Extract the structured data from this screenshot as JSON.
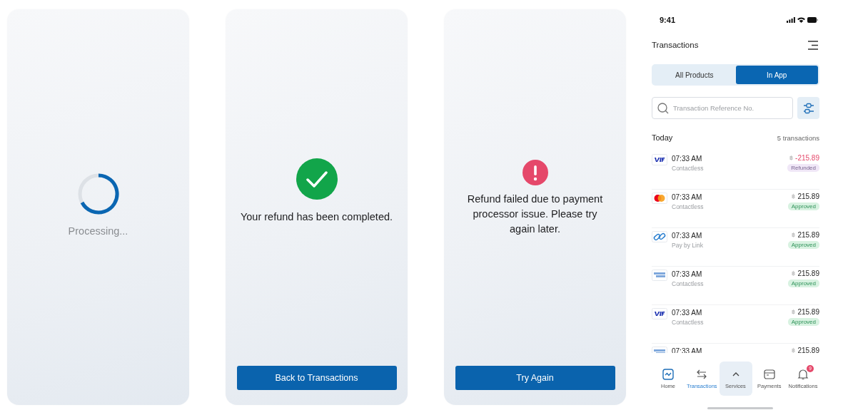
{
  "screens": [
    {
      "kind": "processing",
      "message": "Processing..."
    },
    {
      "kind": "success",
      "message": "Your refund has been completed.",
      "button": "Back to Transactions"
    },
    {
      "kind": "error",
      "message": "Refund failed due to payment processor issue. Please try again later.",
      "button": "Try Again"
    }
  ],
  "phone": {
    "status_bar": {
      "time": "9:41"
    },
    "title": "Transactions",
    "tabs": [
      {
        "label": "All Products",
        "selected": false
      },
      {
        "label": "In App",
        "selected": true
      }
    ],
    "search": {
      "placeholder": "Transaction Reference No."
    },
    "section": {
      "title": "Today",
      "count": "5 transactions"
    },
    "transactions": [
      {
        "kind": "visa",
        "time": "07:33 AM",
        "channel": "Contactless",
        "currency": "฿",
        "amount": "-215.89",
        "status": {
          "label": "Refunded",
          "kind": "refunded"
        }
      },
      {
        "kind": "mastercard",
        "time": "07:33 AM",
        "channel": "Contactless",
        "currency": "฿",
        "amount": "215.89",
        "status": {
          "label": "Approved",
          "kind": "approved"
        }
      },
      {
        "kind": "link",
        "time": "07:33 AM",
        "channel": "Pay by Link",
        "currency": "฿",
        "amount": "215.89",
        "status": {
          "label": "Approved",
          "kind": "approved"
        }
      },
      {
        "kind": "amex",
        "time": "07:33 AM",
        "channel": "Contactless",
        "currency": "฿",
        "amount": "215.89",
        "status": {
          "label": "Approved",
          "kind": "approved"
        }
      },
      {
        "kind": "visa",
        "time": "07:33 AM",
        "channel": "Contactless",
        "currency": "฿",
        "amount": "215.89",
        "status": {
          "label": "Approved",
          "kind": "approved"
        }
      },
      {
        "kind": "amex",
        "time": "07:33 AM",
        "currency": "฿",
        "amount": "215.89"
      }
    ],
    "nav": [
      {
        "kind": "home",
        "label": "Home",
        "selected": false
      },
      {
        "kind": "transfer",
        "label": "Transactions",
        "selected": true
      },
      {
        "kind": "caret",
        "label": "Services",
        "selected": false,
        "highlighted": true
      },
      {
        "kind": "card",
        "label": "Payments",
        "selected": false
      },
      {
        "kind": "bell",
        "label": "Notifications",
        "selected": false,
        "badge": "9"
      }
    ]
  }
}
